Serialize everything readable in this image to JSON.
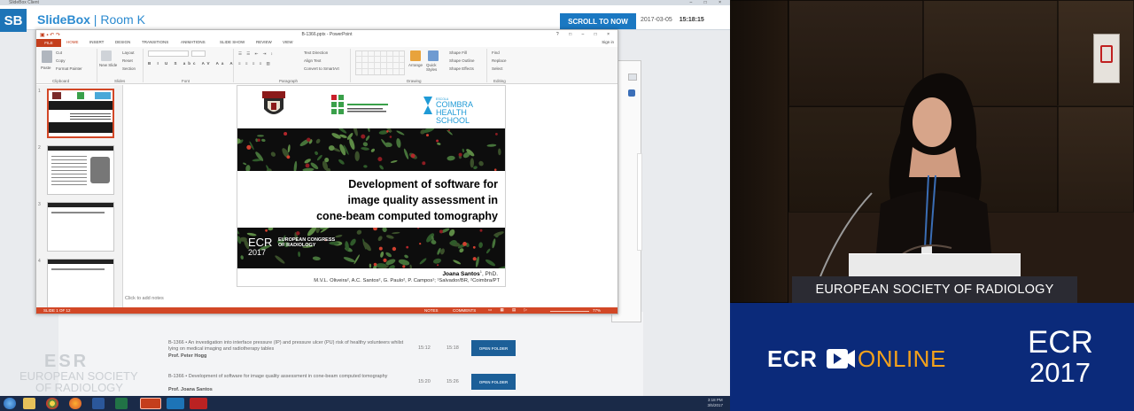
{
  "window": {
    "title": "SlideBox Client",
    "controls": "– □ ×"
  },
  "header": {
    "logo": "SB",
    "brand_name": "SlideBox",
    "room": "Room K",
    "scroll_button": "SCROLL TO NOW",
    "date": "2017-03-05",
    "time": "15:18:15"
  },
  "powerpoint": {
    "title": "B-1366.pptx - PowerPoint",
    "file_tab": "FILE",
    "tabs": [
      "HOME",
      "INSERT",
      "DESIGN",
      "TRANSITIONS",
      "ANIMATIONS",
      "SLIDE SHOW",
      "REVIEW",
      "VIEW"
    ],
    "sign_in": "Sign in",
    "ribbon": {
      "groups": [
        "Clipboard",
        "Slides",
        "Font",
        "Paragraph",
        "Drawing",
        "Editing"
      ],
      "paste": "Paste",
      "cut": "Cut",
      "copy": "Copy",
      "format_painter": "Format Painter",
      "new_slide": "New Slide",
      "layout": "Layout",
      "reset": "Reset",
      "section": "Section",
      "text_direction": "Text Direction",
      "align_text": "Align Text",
      "convert_smartart": "Convert to SmartArt",
      "arrange": "Arrange",
      "quick_styles": "Quick Styles",
      "shape_fill": "Shape Fill",
      "shape_outline": "Shape Outline",
      "shape_effects": "Shape Effects",
      "find": "Find",
      "replace": "Replace",
      "select": "Select"
    },
    "thumb_numbers": [
      "1",
      "2",
      "3",
      "4"
    ],
    "notes_placeholder": "Click to add notes",
    "status": {
      "slide_of": "SLIDE 1 OF 12",
      "notes": "NOTES",
      "comments": "COMMENTS",
      "zoom": "77%"
    },
    "slide": {
      "school_small": "ESCOLA",
      "school_name_1": "COIMBRA",
      "school_name_2": "HEALTH SCHOOL",
      "institute": "INSTITUTO FEDERAL DE EDUCAÇÃO, CIÊNCIA E TECNOLOGIA BAHIA",
      "title_lines": [
        "Development of software for",
        "image quality assessment in",
        "cone-beam computed tomography"
      ],
      "ecr": "ECR",
      "ecr_year": "2017",
      "congress": "EUROPEAN CONGRESS OF RADIOLOGY",
      "author_name": "Joana Santos",
      "author_sup": "1",
      "author_degree": ", PhD.",
      "affiliations": "M.V.L. Oliveira², A.C. Santos², G. Paulo², P. Campos¹; ¹Salvador/BR, ²Coimbra/PT"
    }
  },
  "schedule": {
    "rows": [
      {
        "title": "B-1366 • An investigation into interface pressure (IP) and pressure ulcer (PU) risk of healthy volunteers whilst lying on medical imaging and radiotherapy tables",
        "speaker": "Prof. Peter Hogg",
        "start": "15:12",
        "end": "15:18",
        "button": "OPEN FOLDER"
      },
      {
        "title": "B-1366 • Development of software for image quality assessment in cone-beam computed tomography",
        "speaker": "Prof. Joana Santos",
        "start": "15:20",
        "end": "15:26",
        "button": "OPEN FOLDER"
      }
    ]
  },
  "watermark": {
    "mark": "ESR",
    "line1": "EUROPEAN SOCIETY",
    "line2": "OF RADIOLOGY"
  },
  "taskbar": {
    "time": "3:18 PM",
    "date": "3/5/2017"
  },
  "video": {
    "podium_text": "EUROPEAN SOCIETY OF RADIOLOGY"
  },
  "branding": {
    "ecr": "ECR",
    "online": "ONLINE",
    "ecr_big": "ECR",
    "year": "2017"
  },
  "colors": {
    "slidebox_blue": "#1a78c2",
    "ppt_accent": "#d24726",
    "ecr_online_bg": "#0b2a7a",
    "online_orange": "#f3a11c"
  }
}
